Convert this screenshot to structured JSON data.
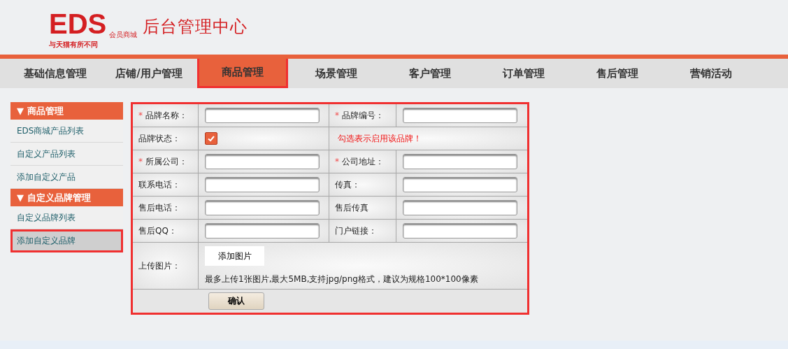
{
  "header": {
    "logo": {
      "mark": "EDS",
      "sub": "会员商城",
      "slogan": "与天猫有所不同"
    },
    "title": "后台管理中心"
  },
  "nav": [
    {
      "label": "基础信息管理",
      "selected": false
    },
    {
      "label": "店铺/用户管理",
      "selected": false
    },
    {
      "label": "商品管理",
      "selected": true
    },
    {
      "label": "场景管理",
      "selected": false
    },
    {
      "label": "客户管理",
      "selected": false
    },
    {
      "label": "订单管理",
      "selected": false
    },
    {
      "label": "售后管理",
      "selected": false
    },
    {
      "label": "营销活动",
      "selected": false
    }
  ],
  "sidebar": [
    {
      "title": "▼ 商品管理",
      "items": [
        {
          "label": "EDS商城产品列表",
          "selected": false
        },
        {
          "label": "自定义产品列表",
          "selected": false
        },
        {
          "label": "添加自定义产品",
          "selected": false
        }
      ]
    },
    {
      "title": "▼ 自定义品牌管理",
      "items": [
        {
          "label": "自定义品牌列表",
          "selected": false
        },
        {
          "label": "添加自定义品牌",
          "selected": true
        }
      ]
    }
  ],
  "form": {
    "rows": [
      {
        "kind": "pair",
        "fields": [
          {
            "label": "品牌名称：",
            "mark": "*"
          },
          {
            "label": "品牌编号：",
            "mark": "*"
          }
        ]
      },
      {
        "kind": "checkbox",
        "label": "品牌状态：",
        "checked": true,
        "hint": "勾选表示启用该品牌！"
      },
      {
        "kind": "pair",
        "fields": [
          {
            "label": "所属公司：",
            "mark": "*"
          },
          {
            "label": "公司地址：",
            "mark": "*"
          }
        ]
      },
      {
        "kind": "pair",
        "fields": [
          {
            "label": "联系电话："
          },
          {
            "label": "传真："
          }
        ]
      },
      {
        "kind": "pair",
        "fields": [
          {
            "label": "售后电话："
          },
          {
            "label": "售后传真"
          }
        ]
      },
      {
        "kind": "pair",
        "fields": [
          {
            "label": "售后QQ："
          },
          {
            "label": "门户链接："
          }
        ]
      },
      {
        "kind": "upload",
        "label": "上传图片：",
        "button": "添加图片",
        "note": "最多上传1张图片,最大5MB,支持jpg/png格式，建议为规格100*100像素"
      },
      {
        "kind": "submit",
        "button": "确认"
      }
    ]
  }
}
